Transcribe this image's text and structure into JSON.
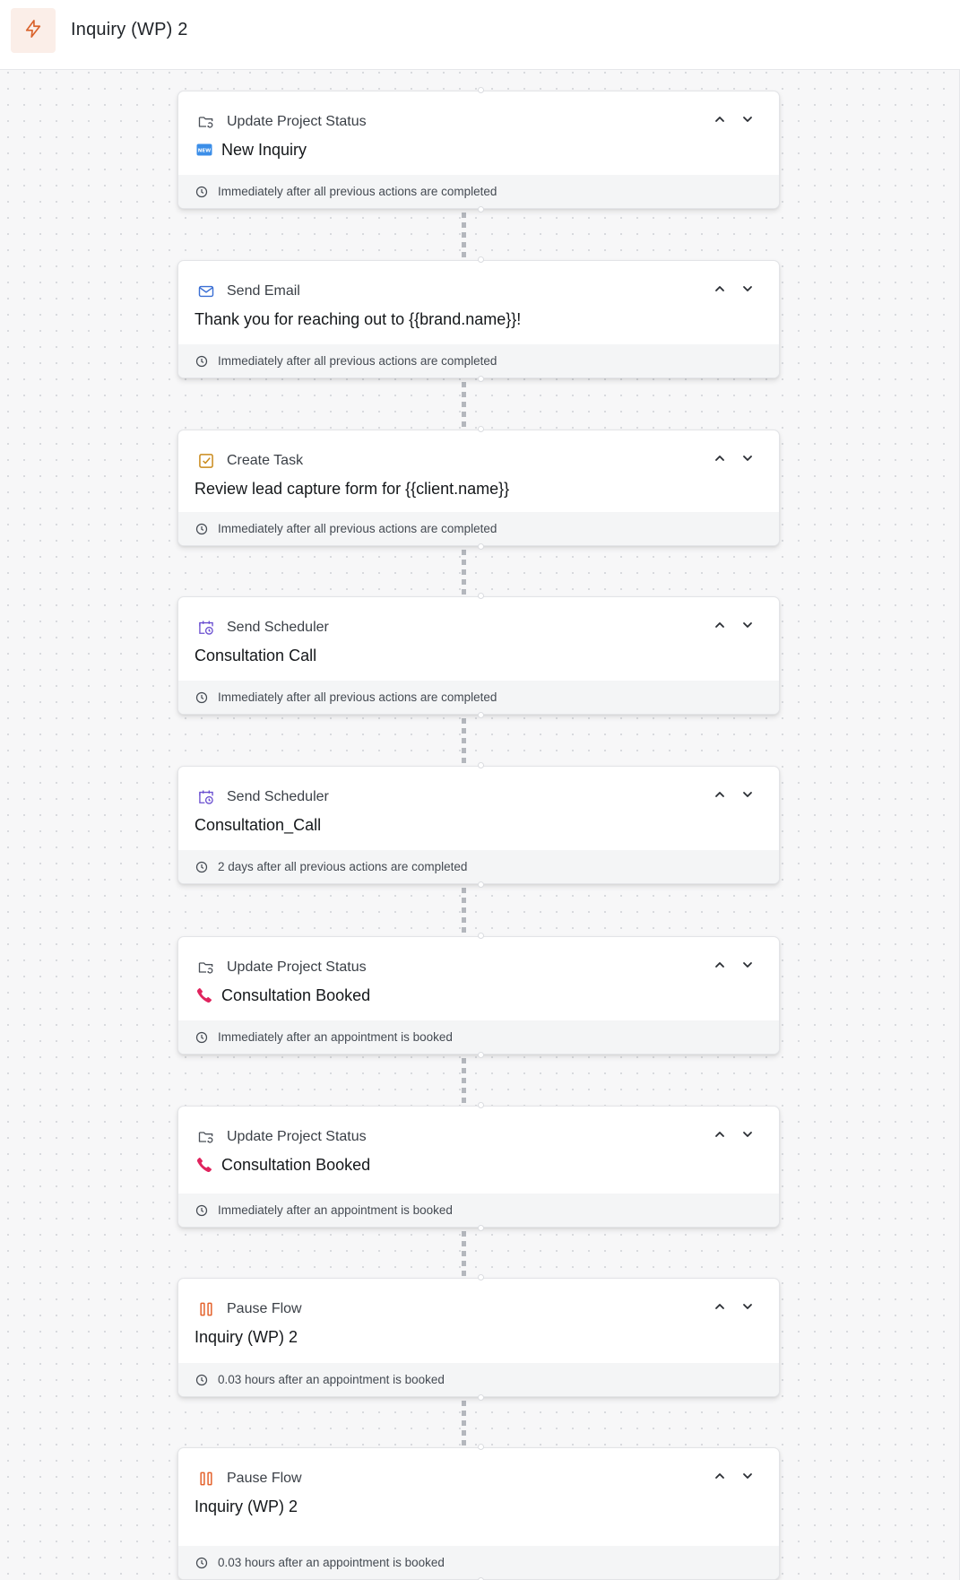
{
  "header": {
    "title": "Inquiry (WP) 2",
    "icon": "lightning-bolt-icon",
    "accent": "#d9622b",
    "badge_bg": "#fbeee8"
  },
  "steps": [
    {
      "type_label": "Update Project Status",
      "type_icon": "folder-sync-icon",
      "title": "New Inquiry",
      "status_icon": "new-badge-icon",
      "timing": "Immediately after all previous actions are completed"
    },
    {
      "type_label": "Send Email",
      "type_icon": "envelope-icon",
      "title": "Thank you for reaching out to {{brand.name}}!",
      "status_icon": null,
      "timing": "Immediately after all previous actions are completed"
    },
    {
      "type_label": "Create Task",
      "type_icon": "checkbox-icon",
      "title": "Review lead capture form for {{client.name}}",
      "status_icon": null,
      "timing": "Immediately after all previous actions are completed"
    },
    {
      "type_label": "Send Scheduler",
      "type_icon": "calendar-clock-icon",
      "title": "Consultation Call",
      "status_icon": null,
      "timing": "Immediately after all previous actions are completed"
    },
    {
      "type_label": "Send Scheduler",
      "type_icon": "calendar-clock-icon",
      "title": "Consultation_Call",
      "status_icon": null,
      "timing": "2 days after all previous actions are completed"
    },
    {
      "type_label": "Update Project Status",
      "type_icon": "folder-sync-icon",
      "title": "Consultation Booked",
      "status_icon": "phone-icon",
      "timing": "Immediately after an appointment is booked"
    },
    {
      "type_label": "Update Project Status",
      "type_icon": "folder-sync-icon",
      "title": "Consultation Booked",
      "status_icon": "phone-icon",
      "timing": "Immediately after an appointment is booked"
    },
    {
      "type_label": "Pause Flow",
      "type_icon": "pause-icon",
      "title": "Inquiry (WP) 2",
      "status_icon": null,
      "timing": "0.03 hours after an appointment is booked"
    },
    {
      "type_label": "Pause Flow",
      "type_icon": "pause-icon",
      "title": "Inquiry (WP) 2",
      "status_icon": null,
      "timing": "0.03 hours after an appointment is booked"
    }
  ],
  "colors": {
    "email": "#3b6fd4",
    "task": "#c98a1b",
    "scheduler": "#6a4fd0",
    "pause": "#e4622c",
    "phone": "#e0245e",
    "new_badge": "#3b8ee8",
    "folder": "#4b5058"
  }
}
